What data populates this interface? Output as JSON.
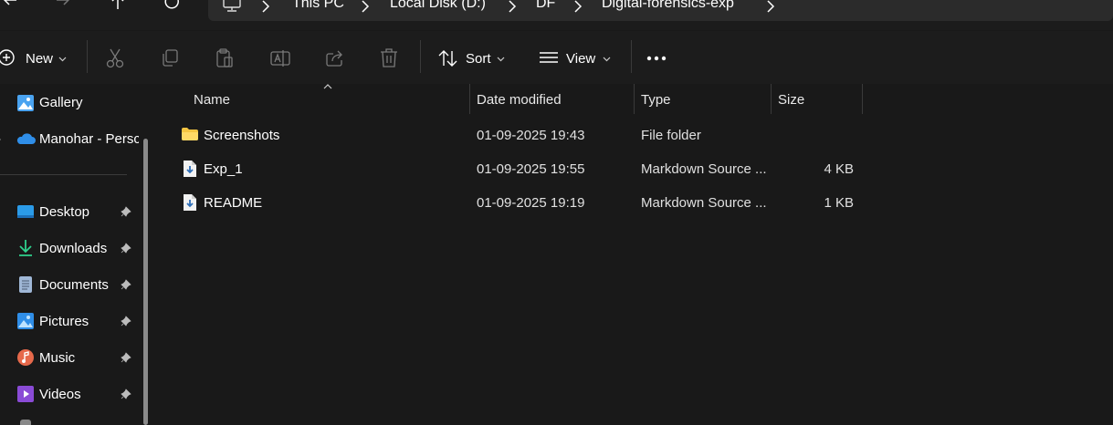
{
  "address_bar": {
    "crumbs": [
      "This PC",
      "Local Disk (D:)",
      "DF",
      "Digital-forensics-exp"
    ]
  },
  "toolbar": {
    "new_label": "New",
    "sort_label": "Sort",
    "view_label": "View"
  },
  "sidebar": {
    "gallery": "Gallery",
    "onedrive": "Manohar - Persc",
    "quick_access": [
      {
        "label": "Desktop",
        "icon": "desktop-icon"
      },
      {
        "label": "Downloads",
        "icon": "downloads-icon"
      },
      {
        "label": "Documents",
        "icon": "documents-icon"
      },
      {
        "label": "Pictures",
        "icon": "pictures-icon"
      },
      {
        "label": "Music",
        "icon": "music-icon"
      },
      {
        "label": "Videos",
        "icon": "videos-icon"
      }
    ]
  },
  "file_list": {
    "columns": [
      "Name",
      "Date modified",
      "Type",
      "Size"
    ],
    "rows": [
      {
        "name": "Screenshots",
        "date": "01-09-2025 19:43",
        "type": "File folder",
        "size": "",
        "icon": "folder-icon"
      },
      {
        "name": "Exp_1",
        "date": "01-09-2025 19:55",
        "type": "Markdown Source ...",
        "size": "4 KB",
        "icon": "markdown-file-icon"
      },
      {
        "name": "README",
        "date": "01-09-2025 19:19",
        "type": "Markdown Source ...",
        "size": "1 KB",
        "icon": "markdown-file-icon"
      }
    ]
  },
  "colors": {
    "background": "#191919",
    "folder": "#f5c542",
    "accent_blue": "#4aa3f0"
  }
}
